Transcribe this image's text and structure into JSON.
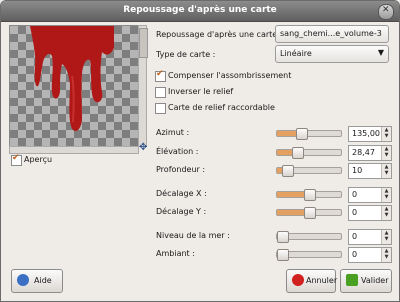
{
  "window": {
    "title": "Repoussage d'après une carte"
  },
  "preview": {
    "apercu_label": "Aperçu",
    "apercu_checked": true
  },
  "form": {
    "map_label": "Repoussage d'après une carte :",
    "map_value": "sang_chemi...e_volume-3",
    "map_type_label": "Type de carte :",
    "map_type_value": "Linéaire",
    "compensate_label": "Compenser l'assombrissement",
    "compensate_checked": true,
    "invert_label": "Inverser le relief",
    "invert_checked": false,
    "tileable_label": "Carte de relief raccordable",
    "tileable_checked": false
  },
  "sliders": [
    {
      "label": "Azimut :",
      "value": "135,00",
      "fraction": 0.375
    },
    {
      "label": "Élévation :",
      "value": "28,47",
      "fraction": 0.32
    },
    {
      "label": "Profondeur :",
      "value": "10",
      "fraction": 0.15
    },
    {
      "label": "Décalage X :",
      "value": "0",
      "fraction": 0.5
    },
    {
      "label": "Décalage Y :",
      "value": "0",
      "fraction": 0.5
    },
    {
      "label": "Niveau de la mer :",
      "value": "0",
      "fraction": 0.0
    },
    {
      "label": "Ambiant :",
      "value": "0",
      "fraction": 0.0
    }
  ],
  "buttons": {
    "help": "Aide",
    "cancel": "Annuler",
    "ok": "Valider"
  },
  "colors": {
    "accent": "#e4a060",
    "blood": "#b01818"
  }
}
